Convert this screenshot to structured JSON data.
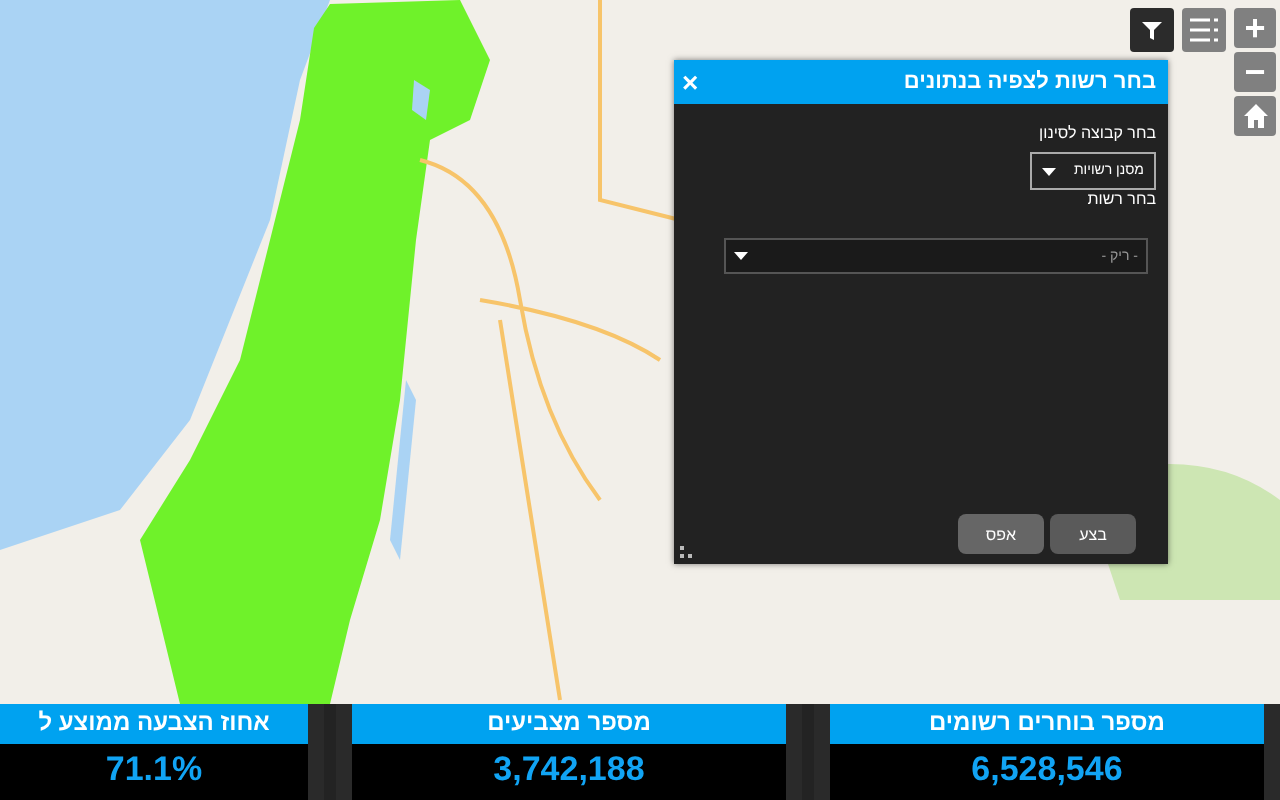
{
  "map_controls": {
    "zoom_in": "+",
    "zoom_out": "−"
  },
  "dialog": {
    "title": "בחר רשות לצפיה בנתונים",
    "close": "×",
    "group_label": "בחר קבוצה לסינון",
    "group_select": {
      "value": "מסנן רשויות"
    },
    "authority_label": "בחר רשות",
    "authority_select": {
      "placeholder": "- ריק -"
    },
    "buttons": [
      {
        "label": "בצע",
        "kind": "apply"
      },
      {
        "label": "אפס",
        "kind": "reset"
      }
    ]
  },
  "stats": [
    {
      "title": "מספר בוחרים רשומים",
      "value": "6,528,546"
    },
    {
      "title": "מספר מצביעים",
      "value": "3,742,188"
    },
    {
      "title": "אחוז הצבעה ממוצע ל",
      "value": "71.1%"
    }
  ]
}
